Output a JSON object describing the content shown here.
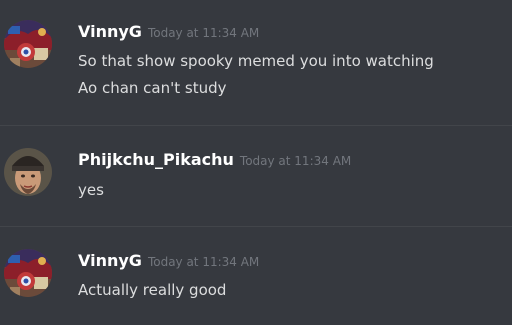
{
  "messages": [
    {
      "username": "VinnyG",
      "timestamp": "Today at 11:34 AM",
      "lines": [
        "So that show spooky memed you into watching",
        "Ao chan can't study"
      ],
      "avatar_icon": "anime-character-avatar-icon"
    },
    {
      "username": "Phijkchu_Pikachu",
      "timestamp": "Today at 11:34 AM",
      "lines": [
        "yes"
      ],
      "avatar_icon": "man-with-beanie-avatar-icon"
    },
    {
      "username": "VinnyG",
      "timestamp": "Today at 11:34 AM",
      "lines": [
        "Actually really good"
      ],
      "avatar_icon": "anime-character-avatar-icon"
    }
  ],
  "colors": {
    "background": "#36393f",
    "divider": "#42454a",
    "username": "#ffffff",
    "timestamp": "#72767d",
    "message_text": "#dcddde"
  }
}
